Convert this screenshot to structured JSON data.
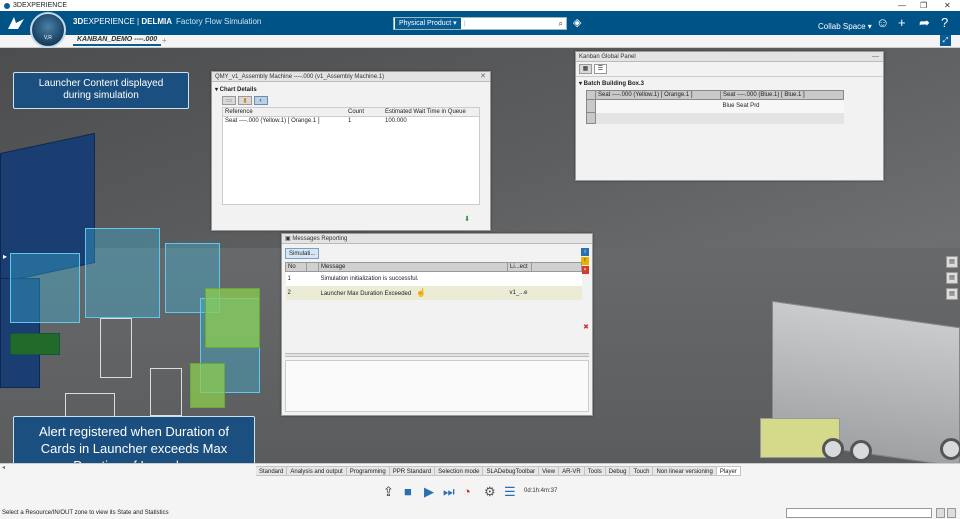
{
  "window": {
    "title": "3DEXPERIENCE",
    "controls": [
      "—",
      "❐",
      "✕"
    ]
  },
  "topbar": {
    "brand_3d": "3D",
    "brand_rest": "EXPERIENCE | ",
    "brand_delmia": "DELMIA",
    "app_name": "Factory Flow Simulation",
    "compass_version": "V,R",
    "search_dropdown": "Physical Product ▾",
    "search_placeholder": "|",
    "collab_space": "Collab Space ▾",
    "icons": [
      "user-icon",
      "plus-icon",
      "share-icon",
      "help-icon"
    ]
  },
  "tabs": {
    "active": "KANBAN_DEMO ----.000",
    "plus": "+"
  },
  "callouts": {
    "top": "Launcher Content displayed during simulation",
    "bottom": "Alert registered when Duration of Cards in Launcher exceeds Max Duration of Launcher"
  },
  "qmy_panel": {
    "title": "QMY_v1_Assembly Machine ----.000 (v1_Assembly Machine.1)",
    "section": "▾ Chart Details",
    "columns": [
      "Reference",
      "Count",
      "Estimated Wait Time in Queue"
    ],
    "rows": [
      [
        "Seat ----.000 (Yellow.1) [ Orange.1 ]",
        "1",
        "100.000"
      ]
    ]
  },
  "kanban_panel": {
    "title": "Kanban Global Panel",
    "section": "▾ Batch Building Box.3",
    "col1": "Seat ----.000 (Yellow.1) [ Orange.1 ]",
    "col2": "Seat ----.000 (Blue.1) [ Blue.1 ]",
    "cell": "Blue Seat Prd"
  },
  "messages_panel": {
    "title": "Messages Reporting",
    "filter_button": "Simulati...",
    "columns": [
      "No",
      "",
      "Message",
      "Li...ect",
      ""
    ],
    "rows": [
      {
        "no": "1",
        "message": "Simulation initialization is successful.",
        "object": ""
      },
      {
        "no": "2",
        "message": "Launcher Max Duration Exceeded",
        "object": "v1_...e"
      }
    ]
  },
  "toolbar_tabs": [
    "Standard",
    "Analysis and output",
    "Programming",
    "PPR Standard",
    "Selection mode",
    "SLADebugToolbar",
    "View",
    "AR-VR",
    "Tools",
    "Debug",
    "Touch",
    "Non linear versioning",
    "Player"
  ],
  "player": {
    "time": "0d:1h:4m:37"
  },
  "status_bar": {
    "text": "Select a Resource/IN/OUT zone to view its State and Statistics"
  }
}
